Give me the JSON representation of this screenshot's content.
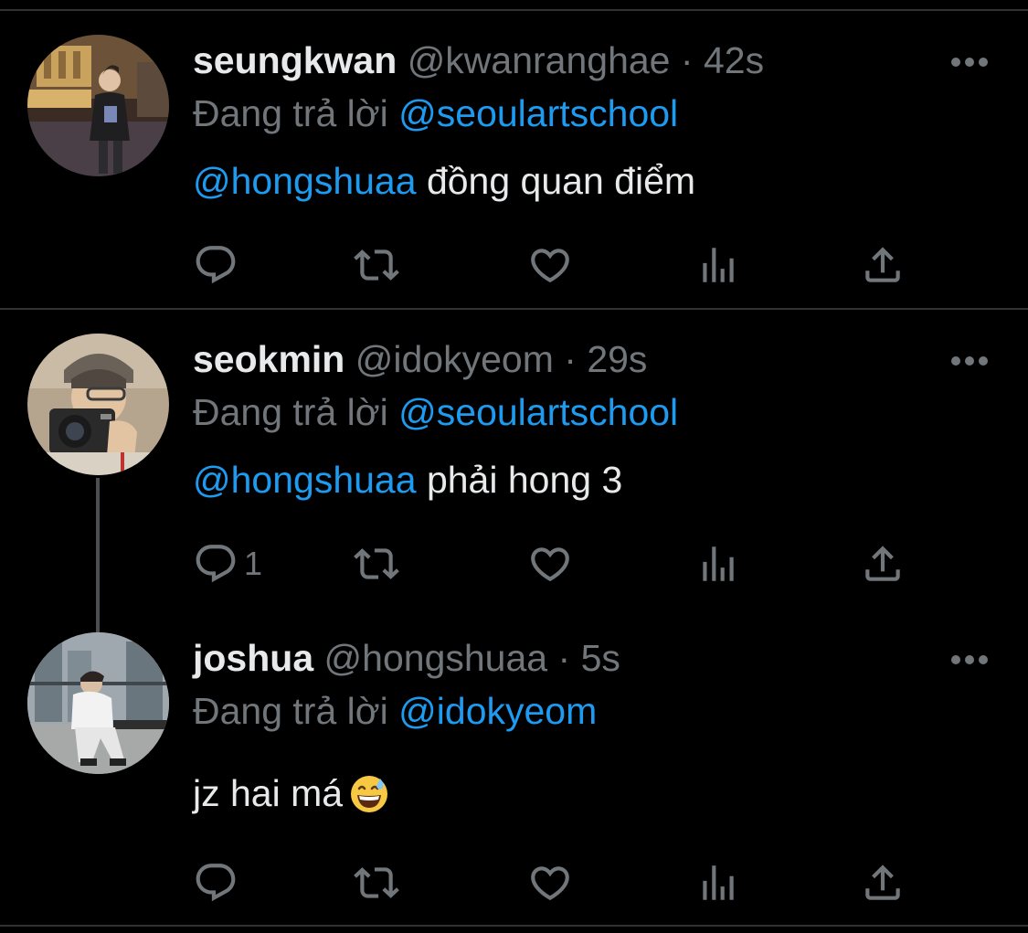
{
  "tweets": [
    {
      "name": "seungkwan",
      "handle": "@kwanranghae",
      "separator": "·",
      "time": "42s",
      "reply_prefix": "Đang trả lời",
      "reply_to": "@seoulartschool",
      "mention": "@hongshuaa",
      "text": "đồng quan điểm",
      "reply_count": ""
    },
    {
      "name": "seokmin",
      "handle": "@idokyeom",
      "separator": "·",
      "time": "29s",
      "reply_prefix": "Đang trả lời",
      "reply_to": "@seoulartschool",
      "mention": "@hongshuaa",
      "text": "phải hong 3",
      "reply_count": "1"
    },
    {
      "name": "joshua",
      "handle": "@hongshuaa",
      "separator": "·",
      "time": "5s",
      "reply_prefix": "Đang trả lời",
      "reply_to": "@idokyeom",
      "mention": "",
      "text": "jz hai má",
      "emoji": "grinning-face-with-sweat",
      "reply_count": ""
    }
  ],
  "icons": {
    "reply": "reply-icon",
    "retweet": "retweet-icon",
    "like": "heart-icon",
    "views": "views-icon",
    "share": "share-icon",
    "more": "more-icon"
  },
  "colors": {
    "background": "#000000",
    "text": "#e7e9ea",
    "muted": "#71767b",
    "link": "#1d9bf0",
    "divider": "#2f3336"
  }
}
